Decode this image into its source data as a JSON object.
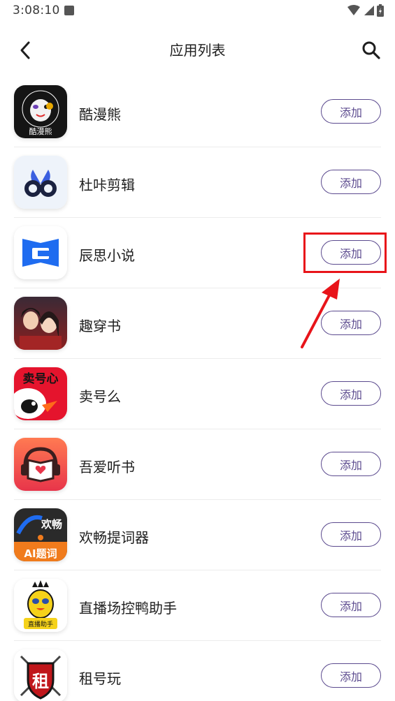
{
  "status_bar": {
    "time": "3:08:10"
  },
  "header": {
    "title": "应用列表"
  },
  "apps": [
    {
      "name": "酷漫熊",
      "add_label": "添加"
    },
    {
      "name": "杜咔剪辑",
      "add_label": "添加"
    },
    {
      "name": "辰思小说",
      "add_label": "添加"
    },
    {
      "name": "趣穿书",
      "add_label": "添加"
    },
    {
      "name": "卖号么",
      "add_label": "添加"
    },
    {
      "name": "吾爱听书",
      "add_label": "添加"
    },
    {
      "name": "欢畅提词器",
      "add_label": "添加"
    },
    {
      "name": "直播场控鸭助手",
      "add_label": "添加"
    },
    {
      "name": "租号玩",
      "add_label": "添加"
    }
  ],
  "icon_text": {
    "kumanxiong": "酷漫熊",
    "maihaome": "卖号心",
    "huanchang_top": "欢畅",
    "huanchang_bottom": "AI题词",
    "zhibo": "直播助手",
    "zuhaowan": "租"
  },
  "colors": {
    "accent": "#5b4a8e",
    "highlight": "#e8141a",
    "divider": "#ececec"
  }
}
